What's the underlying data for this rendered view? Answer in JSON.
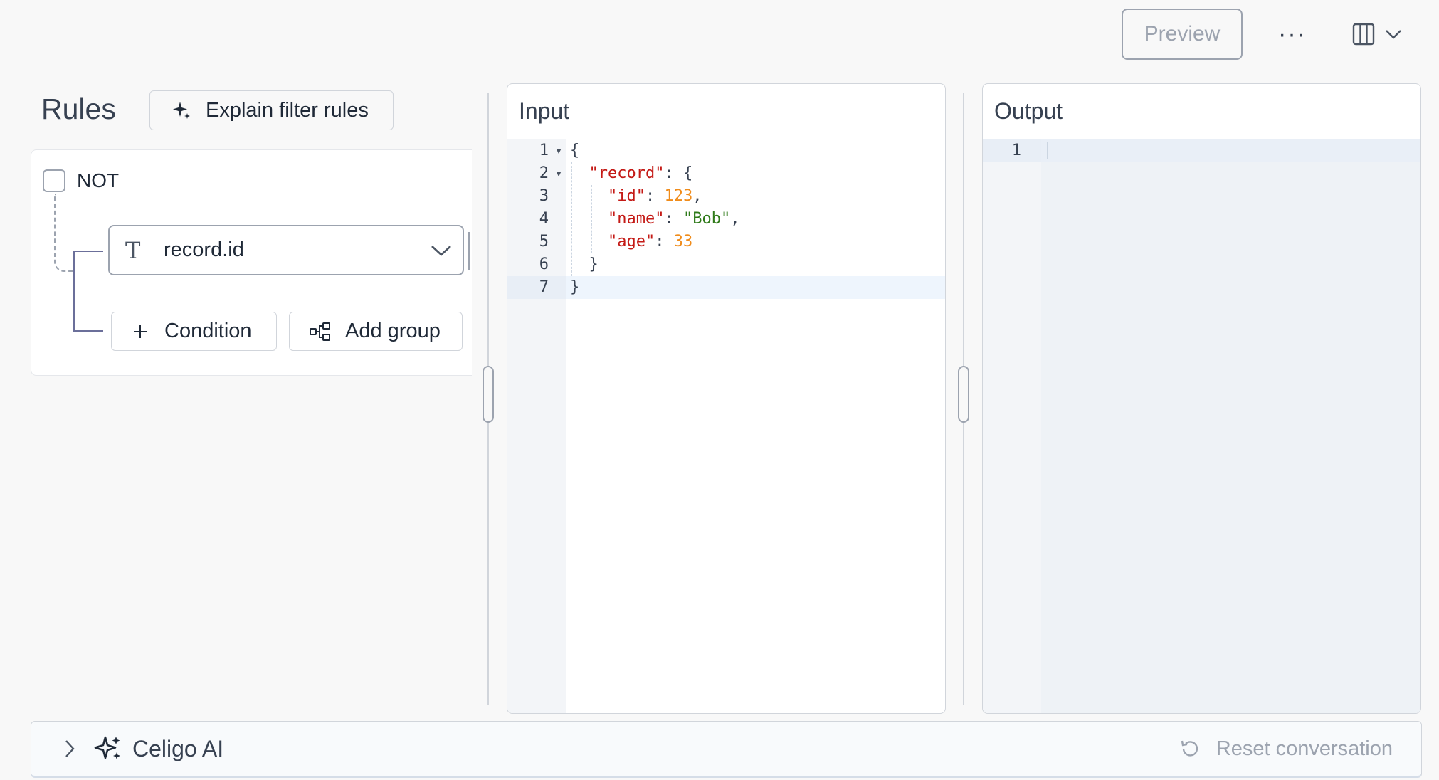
{
  "toolbar": {
    "preview_label": "Preview",
    "more_label": "···",
    "layout_icon": "columns-icon"
  },
  "rules": {
    "title": "Rules",
    "explain_label": "Explain filter rules",
    "not_label": "NOT",
    "not_checked": false,
    "field_value": "record.id",
    "field_type_glyph": "T",
    "condition_label": "Condition",
    "add_group_label": "Add group"
  },
  "input": {
    "title": "Input",
    "line_numbers": [
      "1",
      "2",
      "3",
      "4",
      "5",
      "6",
      "7"
    ],
    "lines": [
      [
        {
          "t": "{",
          "c": "p"
        }
      ],
      [
        {
          "t": "  ",
          "c": "p"
        },
        {
          "t": "\"record\"",
          "c": "k"
        },
        {
          "t": ": {",
          "c": "p"
        }
      ],
      [
        {
          "t": "    ",
          "c": "p"
        },
        {
          "t": "\"id\"",
          "c": "k"
        },
        {
          "t": ": ",
          "c": "p"
        },
        {
          "t": "123",
          "c": "n"
        },
        {
          "t": ",",
          "c": "p"
        }
      ],
      [
        {
          "t": "    ",
          "c": "p"
        },
        {
          "t": "\"name\"",
          "c": "k"
        },
        {
          "t": ": ",
          "c": "p"
        },
        {
          "t": "\"Bob\"",
          "c": "s"
        },
        {
          "t": ",",
          "c": "p"
        }
      ],
      [
        {
          "t": "    ",
          "c": "p"
        },
        {
          "t": "\"age\"",
          "c": "k"
        },
        {
          "t": ": ",
          "c": "p"
        },
        {
          "t": "33",
          "c": "n"
        }
      ],
      [
        {
          "t": "  }",
          "c": "p"
        }
      ],
      [
        {
          "t": "}",
          "c": "p"
        }
      ]
    ],
    "folded_lines": [
      1,
      2
    ],
    "active_line": 7
  },
  "output": {
    "title": "Output",
    "line_numbers": [
      "1"
    ]
  },
  "ai": {
    "title": "Celigo AI",
    "reset_label": "Reset conversation"
  }
}
